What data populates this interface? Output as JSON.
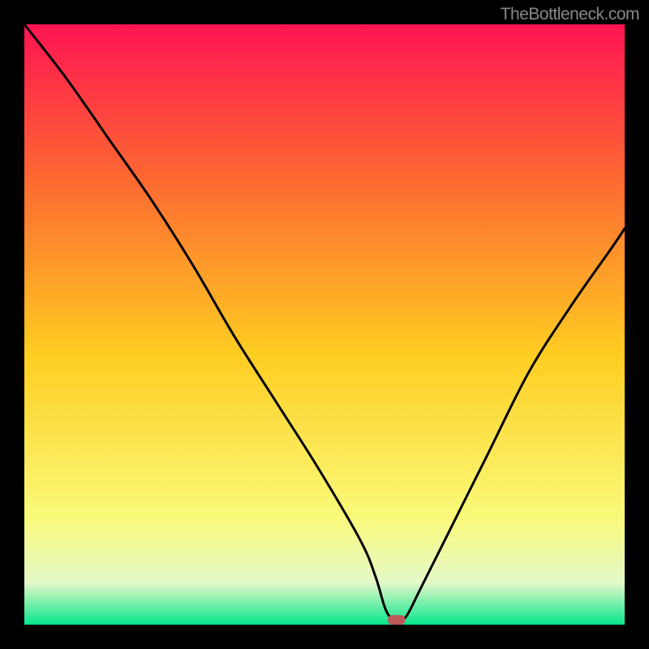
{
  "watermark": "TheBottleneck.com",
  "chart_data": {
    "type": "line",
    "title": "",
    "xlabel": "",
    "ylabel": "",
    "xlim": [
      0,
      100
    ],
    "ylim": [
      0,
      100
    ],
    "gradient_colors": {
      "top": "#FF1452",
      "quarter": "#FC6632",
      "mid": "#FECD21",
      "lower": "#FAFA79",
      "near_bottom": "#E4F9C8",
      "bottom": "#08E68C"
    },
    "series": [
      {
        "name": "bottleneck-curve",
        "x": [
          0,
          7,
          14,
          21,
          28,
          35,
          42,
          49,
          56,
          58.5,
          60,
          61,
          62,
          63,
          64,
          66,
          70,
          77,
          84,
          91,
          98,
          100
        ],
        "values": [
          100,
          91,
          81,
          71,
          60,
          48,
          37,
          26,
          14,
          8,
          3,
          1.2,
          0.8,
          0.8,
          2,
          6,
          14,
          28,
          42,
          53,
          63,
          66
        ]
      }
    ],
    "marker": {
      "x": 62,
      "y": 0.8,
      "color": "#BC5A5A"
    }
  }
}
